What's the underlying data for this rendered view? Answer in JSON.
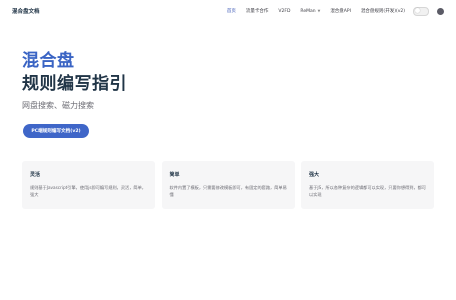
{
  "nav": {
    "brand": "混合盘文档",
    "items": [
      {
        "label": "首页",
        "active": true
      },
      {
        "label": "流量卡合作"
      },
      {
        "label": "V2FD"
      },
      {
        "label": "ReMan",
        "dropdown": true
      },
      {
        "label": "混合盘API"
      },
      {
        "label": "混合盘规则(开发)(v2)"
      }
    ],
    "theme_toggle_icon": "sun-icon",
    "github_icon": "github-icon"
  },
  "hero": {
    "name": "混合盘",
    "text": "规则编写指引",
    "tagline": "网盘搜索、磁力搜索",
    "action_label": "PC端规则编写文档(v2)"
  },
  "features": [
    {
      "title": "灵活",
      "details": "规则基于Javascript引擎，使用js即可编写规则，灵活，简单，强大"
    },
    {
      "title": "简单",
      "details": "软件内置了模板，只需要修改模板即可，有固定的套路，简单易懂"
    },
    {
      "title": "强大",
      "details": "基于JS，所以各种复杂的逻辑都可以实现，只要你想得到，都可以实现"
    }
  ],
  "colors": {
    "brand": "#3a64c4",
    "button": "#3f66c8",
    "active_nav": "#3451b2",
    "card_bg": "#f6f6f7"
  }
}
